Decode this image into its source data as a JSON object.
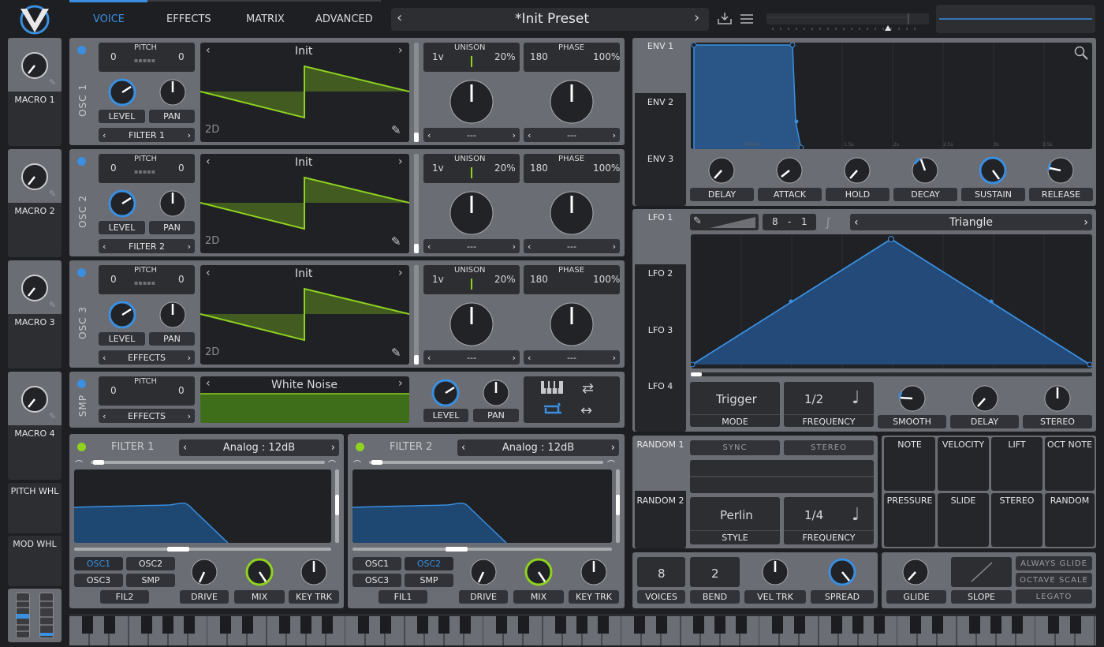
{
  "tabs": [
    "VOICE",
    "EFFECTS",
    "MATRIX",
    "ADVANCED"
  ],
  "preset": {
    "name": "*Init Preset"
  },
  "macros": [
    {
      "label": "MACRO 1",
      "value": 0.3
    },
    {
      "label": "MACRO 2",
      "value": 0.3
    },
    {
      "label": "MACRO 3",
      "value": 0.3
    },
    {
      "label": "MACRO 4",
      "value": 0.3
    }
  ],
  "pitch_wheel": "PITCH WHL",
  "mod_wheel": "MOD WHL",
  "oscillators": [
    {
      "name": "OSC 1",
      "pitch_label": "PITCH",
      "pitch_left": "0",
      "pitch_right": "0",
      "wavetable": "Init",
      "dim": "2D",
      "level": "LEVEL",
      "pan": "PAN",
      "dest": "FILTER 1",
      "unison": "UNISON",
      "voices": "1v",
      "detune": "20%",
      "phase": "PHASE",
      "phase_val": "180",
      "phase_rand": "100%",
      "sel1": "---",
      "sel2": "---"
    },
    {
      "name": "OSC 2",
      "pitch_label": "PITCH",
      "pitch_left": "0",
      "pitch_right": "0",
      "wavetable": "Init",
      "dim": "2D",
      "level": "LEVEL",
      "pan": "PAN",
      "dest": "FILTER 2",
      "unison": "UNISON",
      "voices": "1v",
      "detune": "20%",
      "phase": "PHASE",
      "phase_val": "180",
      "phase_rand": "100%",
      "sel1": "---",
      "sel2": "---"
    },
    {
      "name": "OSC 3",
      "pitch_label": "PITCH",
      "pitch_left": "0",
      "pitch_right": "0",
      "wavetable": "Init",
      "dim": "2D",
      "level": "LEVEL",
      "pan": "PAN",
      "dest": "EFFECTS",
      "unison": "UNISON",
      "voices": "1v",
      "detune": "20%",
      "phase": "PHASE",
      "phase_val": "180",
      "phase_rand": "100%",
      "sel1": "---",
      "sel2": "---"
    }
  ],
  "sampler": {
    "name": "SMP",
    "pitch_label": "PITCH",
    "pitch_left": "0",
    "pitch_right": "0",
    "sample": "White Noise",
    "dest": "EFFECTS",
    "level": "LEVEL",
    "pan": "PAN"
  },
  "filters": [
    {
      "name": "FILTER 1",
      "model": "Analog : 12dB",
      "chips": [
        "OSC1",
        "OSC2",
        "OSC3",
        "SMP",
        "FIL2"
      ],
      "active": "OSC1",
      "drive": "DRIVE",
      "mix": "MIX",
      "keytrk": "KEY TRK"
    },
    {
      "name": "FILTER 2",
      "model": "Analog : 12dB",
      "chips": [
        "OSC1",
        "OSC2",
        "OSC3",
        "SMP",
        "FIL1"
      ],
      "active": "OSC2",
      "drive": "DRIVE",
      "mix": "MIX",
      "keytrk": "KEY TRK"
    }
  ],
  "envelopes": {
    "tabs": [
      "ENV 1",
      "ENV 2",
      "ENV 3"
    ],
    "knobs": [
      "DELAY",
      "ATTACK",
      "HOLD",
      "DECAY",
      "SUSTAIN",
      "RELEASE"
    ],
    "time_marks": [
      "500ms",
      "1s",
      "1.5s",
      "2s",
      "2.5s",
      "3s",
      "3.5s"
    ]
  },
  "lfos": {
    "tabs": [
      "LFO 1",
      "LFO 2",
      "LFO 3",
      "LFO 4"
    ],
    "rate_left": "8",
    "rate_sep": "-",
    "rate_right": "1",
    "shape": "Triangle",
    "mode_value": "Trigger",
    "mode": "MODE",
    "freq_value": "1/2",
    "frequency": "FREQUENCY",
    "smooth": "SMOOTH",
    "delay": "DELAY",
    "stereo": "STEREO"
  },
  "random": {
    "tabs": [
      "RANDOM 1",
      "RANDOM 2"
    ],
    "sync": "SYNC",
    "stereo": "STEREO",
    "style_value": "Perlin",
    "style": "STYLE",
    "freq_value": "1/4",
    "frequency": "FREQUENCY"
  },
  "sources": [
    "NOTE",
    "VELOCITY",
    "LIFT",
    "OCT NOTE",
    "PRESSURE",
    "SLIDE",
    "STEREO",
    "RANDOM"
  ],
  "voice": {
    "voices_value": "8",
    "voices": "VOICES",
    "bend_value": "2",
    "bend": "BEND",
    "vel_trk": "VEL TRK",
    "spread": "SPREAD"
  },
  "glide": {
    "glide": "GLIDE",
    "slope": "SLOPE",
    "always": "ALWAYS GLIDE",
    "octave": "OCTAVE SCALE",
    "legato": "LEGATO"
  },
  "colors": {
    "accent": "#3a8fe0",
    "osc_wave": "#8fd21f",
    "env_fill": "#2a5687",
    "bg": "#1d1f22",
    "panel": "#6a6d73"
  }
}
